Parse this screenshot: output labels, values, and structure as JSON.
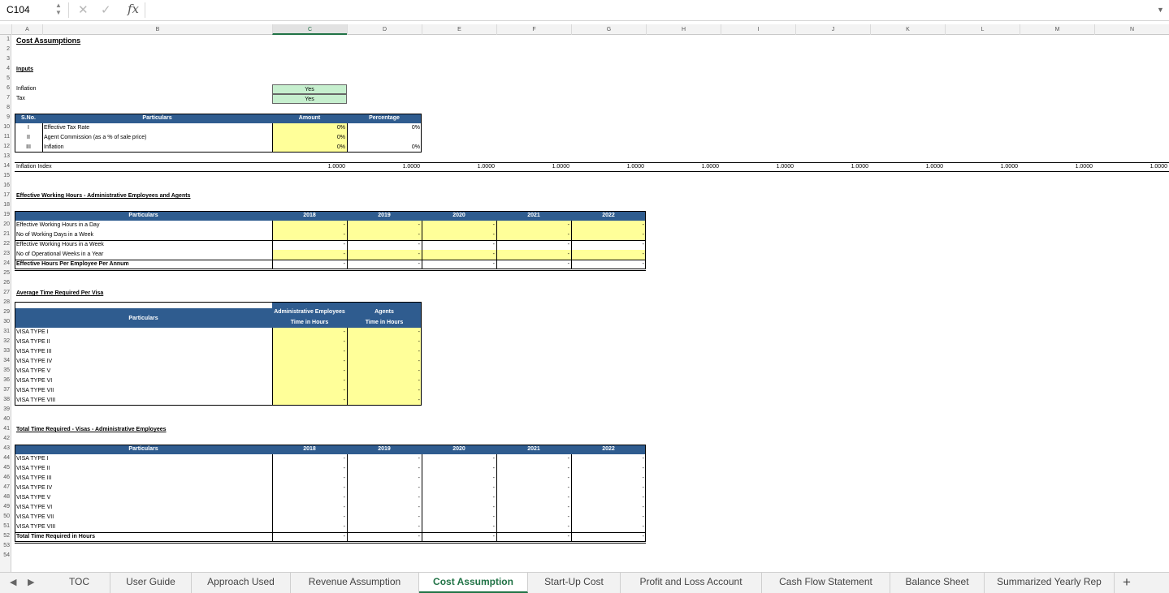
{
  "formula_bar": {
    "name_box": "C104",
    "formula": ""
  },
  "columns": [
    "A",
    "B",
    "C",
    "D",
    "E",
    "F",
    "G",
    "H",
    "I",
    "J",
    "K",
    "L",
    "M",
    "N"
  ],
  "rows": [
    "1",
    "2",
    "3",
    "4",
    "5",
    "6",
    "7",
    "8",
    "9",
    "10",
    "11",
    "12",
    "13",
    "14",
    "15",
    "16",
    "17",
    "18",
    "19",
    "20",
    "21",
    "22",
    "23",
    "24",
    "25",
    "26",
    "27",
    "28",
    "29",
    "30",
    "31",
    "32",
    "33",
    "34",
    "35",
    "36",
    "37",
    "38",
    "39",
    "40",
    "41",
    "42",
    "43",
    "44",
    "45",
    "46",
    "47",
    "48",
    "49",
    "50",
    "51",
    "52",
    "53",
    "54"
  ],
  "title": "Cost Assumptions",
  "inputs": {
    "heading": "Inputs",
    "inflation_label": "Inflation",
    "inflation_value": "Yes",
    "tax_label": "Tax",
    "tax_value": "Yes"
  },
  "params": {
    "headers": [
      "S.No.",
      "Particulars",
      "Amount",
      "Percentage"
    ],
    "rows": [
      {
        "sno": "I",
        "label": "Effective Tax Rate",
        "amount": "0%",
        "pct": "0%"
      },
      {
        "sno": "II",
        "label": "Agent Commission (as a % of sale price)",
        "amount": "0%",
        "pct": ""
      },
      {
        "sno": "III",
        "label": "Inflation",
        "amount": "0%",
        "pct": "0%"
      }
    ]
  },
  "inflation_index": {
    "label": "Inflation Index",
    "values": [
      "1.0000",
      "1.0000",
      "1.0000",
      "1.0000",
      "1.0000",
      "1.0000",
      "1.0000",
      "1.0000",
      "1.0000",
      "1.0000",
      "1.0000",
      "1.0000"
    ]
  },
  "working_hours": {
    "heading": "Effective Working Hours - Administrative Employees and Agents",
    "header": "Particulars",
    "years": [
      "2018",
      "2019",
      "2020",
      "2021",
      "2022"
    ],
    "rows": [
      "Effective Working Hours in a Day",
      "No of Working Days in a Week",
      "Effective Working Hours in a Week",
      "No of Operational Weeks in a Year"
    ],
    "total": "Effective Hours Per Employee Per Annum",
    "dash": "-"
  },
  "avg_time": {
    "heading": "Average Time Required Per Visa",
    "header": "Particulars",
    "col1": "Administrative Employees",
    "col2": "Agents",
    "sub": "Time in Hours",
    "visas": [
      "VISA TYPE I",
      "VISA TYPE II",
      "VISA TYPE III",
      "VISA TYPE IV",
      "VISA TYPE V",
      "VISA TYPE VI",
      "VISA TYPE VII",
      "VISA TYPE VIII"
    ]
  },
  "total_time": {
    "heading": "Total Time Required - Visas - Administrative Employees",
    "header": "Particulars",
    "years": [
      "2018",
      "2019",
      "2020",
      "2021",
      "2022"
    ],
    "visas": [
      "VISA TYPE I",
      "VISA TYPE II",
      "VISA TYPE III",
      "VISA TYPE IV",
      "VISA TYPE V",
      "VISA TYPE VI",
      "VISA TYPE VII",
      "VISA TYPE VIII"
    ],
    "total": "Total Time Required in Hours"
  },
  "tabs": [
    "TOC",
    "User Guide",
    "Approach Used",
    "Revenue Assumption",
    "Cost Assumption",
    "Start-Up Cost",
    "Profit and Loss Account",
    "Cash Flow Statement",
    "Balance Sheet",
    "Summarized Yearly Rep"
  ],
  "active_tab": "Cost Assumption",
  "colors": {
    "header_blue": "#2f5c8f",
    "input_yellow": "#ffff99",
    "input_green": "#c6efce",
    "excel_green": "#217346"
  }
}
